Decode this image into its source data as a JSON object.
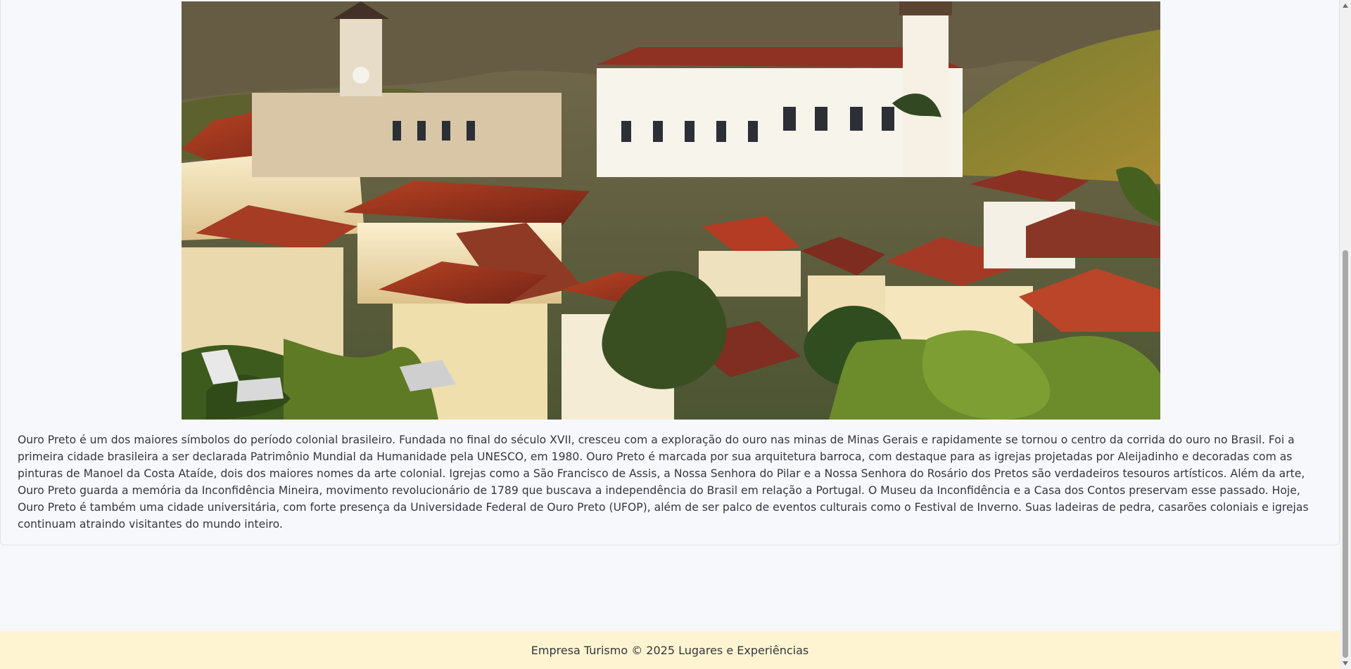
{
  "content": {
    "image_alt": "Ouro Preto",
    "description": "Ouro Preto é um dos maiores símbolos do período colonial brasileiro. Fundada no final do século XVII, cresceu com a exploração do ouro nas minas de Minas Gerais e rapidamente se tornou o centro da corrida do ouro no Brasil. Foi a primeira cidade brasileira a ser declarada Patrimônio Mundial da Humanidade pela UNESCO, em 1980. Ouro Preto é marcada por sua arquitetura barroca, com destaque para as igrejas projetadas por Aleijadinho e decoradas com as pinturas de Manoel da Costa Ataíde, dois dos maiores nomes da arte colonial. Igrejas como a São Francisco de Assis, a Nossa Senhora do Pilar e a Nossa Senhora do Rosário dos Pretos são verdadeiros tesouros artísticos. Além da arte, Ouro Preto guarda a memória da Inconfidência Mineira, movimento revolucionário de 1789 que buscava a independência do Brasil em relação a Portugal. O Museu da Inconfidência e a Casa dos Contos preservam esse passado. Hoje, Ouro Preto é também uma cidade universitária, com forte presença da Universidade Federal de Ouro Preto (UFOP), além de ser palco de eventos culturais como o Festival de Inverno. Suas ladeiras de pedra, casarões coloniais e igrejas continuam atraindo visitantes do mundo inteiro."
  },
  "footer": {
    "text": "Empresa Turismo © 2025 Lugares e Experiências"
  },
  "colors": {
    "page_background": "#f7f8fb",
    "footer_background": "#fff4d1",
    "text": "#33373d",
    "card_border": "#dfe2e8"
  },
  "icons": {
    "scroll_up": "scroll-up-arrow-icon",
    "scroll_down": "scroll-down-arrow-icon"
  }
}
